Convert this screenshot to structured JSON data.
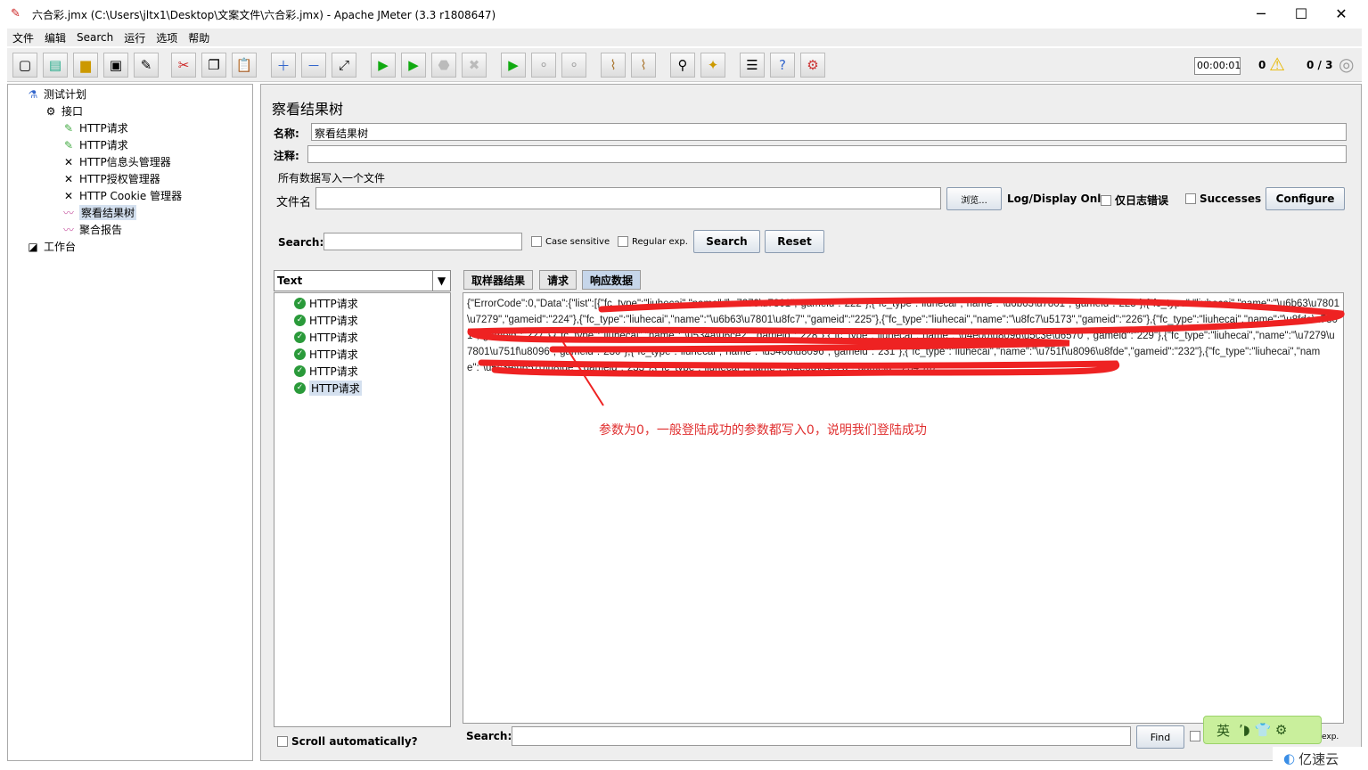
{
  "window": {
    "title": "六合彩.jmx (C:\\Users\\jltx1\\Desktop\\文案文件\\六合彩.jmx) - Apache JMeter (3.3 r1808647)"
  },
  "menu": [
    "文件",
    "编辑",
    "Search",
    "运行",
    "选项",
    "帮助"
  ],
  "status": {
    "timer": "00:00:01",
    "warnings": "0",
    "threads": "0 / 3"
  },
  "tree": [
    {
      "label": "测试计划",
      "icon": "test-plan-icon"
    },
    {
      "label": "接口",
      "icon": "thread-group-icon"
    },
    {
      "label": "HTTP请求",
      "icon": "sampler-icon"
    },
    {
      "label": "HTTP请求",
      "icon": "sampler-icon"
    },
    {
      "label": "HTTP信息头管理器",
      "icon": "config-icon"
    },
    {
      "label": "HTTP授权管理器",
      "icon": "config-icon"
    },
    {
      "label": "HTTP Cookie 管理器",
      "icon": "config-icon"
    },
    {
      "label": "察看结果树",
      "icon": "listener-icon"
    },
    {
      "label": "聚合报告",
      "icon": "listener-icon"
    },
    {
      "label": "工作台",
      "icon": "workbench-icon"
    }
  ],
  "panel": {
    "title": "察看结果树",
    "name_label": "名称:",
    "name_value": "察看结果树",
    "comment_label": "注释:",
    "file_section": "所有数据写入一个文件",
    "filename_label": "文件名",
    "browse": "浏览...",
    "log_only": "Log/Display Only:",
    "errors_only": "仅日志错误",
    "successes": "Successes",
    "configure": "Configure",
    "search_label": "Search:",
    "case_sensitive": "Case sensitive",
    "regex": "Regular exp.",
    "search_btn": "Search",
    "reset_btn": "Reset",
    "renderer": "Text",
    "results": [
      "HTTP请求",
      "HTTP请求",
      "HTTP请求",
      "HTTP请求",
      "HTTP请求",
      "HTTP请求"
    ],
    "scroll_auto": "Scroll automatically?",
    "tabs": [
      "取样器结果",
      "请求",
      "响应数据"
    ],
    "response": "{\"ErrorCode\":0,\"Data\":{\"list\":[{\"fc_type\":\"liuhecai\",\"name\":\"\\u7279\\u7801\",\"gameid\":\"222\"},{\"fc_type\":\"liuhecai\",\"name\":\"\\u6b63\\u7801\",\"gameid\":\"223\"},{\"fc_type\":\"liuhecai\",\"name\":\"\\u6b63\\u7801\\u7279\",\"gameid\":\"224\"},{\"fc_type\":\"liuhecai\",\"name\":\"\\u6b63\\u7801\\u8fc7\",\"gameid\":\"225\"},{\"fc_type\":\"liuhecai\",\"name\":\"\\u8fc7\\u5173\",\"gameid\":\"226\"},{\"fc_type\":\"liuhecai\",\"name\":\"\\u8fde\\u7801\",\"gameid\":\"227\"},{\"fc_type\":\"liuhecai\",\"name\":\"\\u534a\\u6ce2\",\"gameid\":\"228\"},{\"fc_type\":\"liuhecai\",\"name\":\"\\u4e00\\u8096\\u5c3e\\u6570\",\"gameid\":\"229\"},{\"fc_type\":\"liuhecai\",\"name\":\"\\u7279\\u7801\\u751f\\u8096\",\"gameid\":\"230\"},{\"fc_type\":\"liuhecai\",\"name\":\"\\u5408\\u8096\",\"gameid\":\"231\"},{\"fc_type\":\"liuhecai\",\"name\":\"\\u751f\\u8096\\u8fde\",\"gameid\":\"232\"},{\"fc_type\":\"liuhecai\",\"name\":\"\\u5c3e\\u6570\\u8fde\",\"gameid\":\"233\"},{\"fc_type\":\"liuhecai\",\"name\":\"\\u4e0d\\u4e2d\",\"gameid\":\"234\"}]}}",
    "bottom_search": "Search:",
    "find": "Find",
    "exp": "exp."
  },
  "annotation": "参数为0，一般登陆成功的参数都写入0，说明我们登陆成功",
  "ime": "英",
  "watermark": "亿速云",
  "colors": {
    "annotation": "#e03030",
    "selection": "#d4e0ef"
  }
}
